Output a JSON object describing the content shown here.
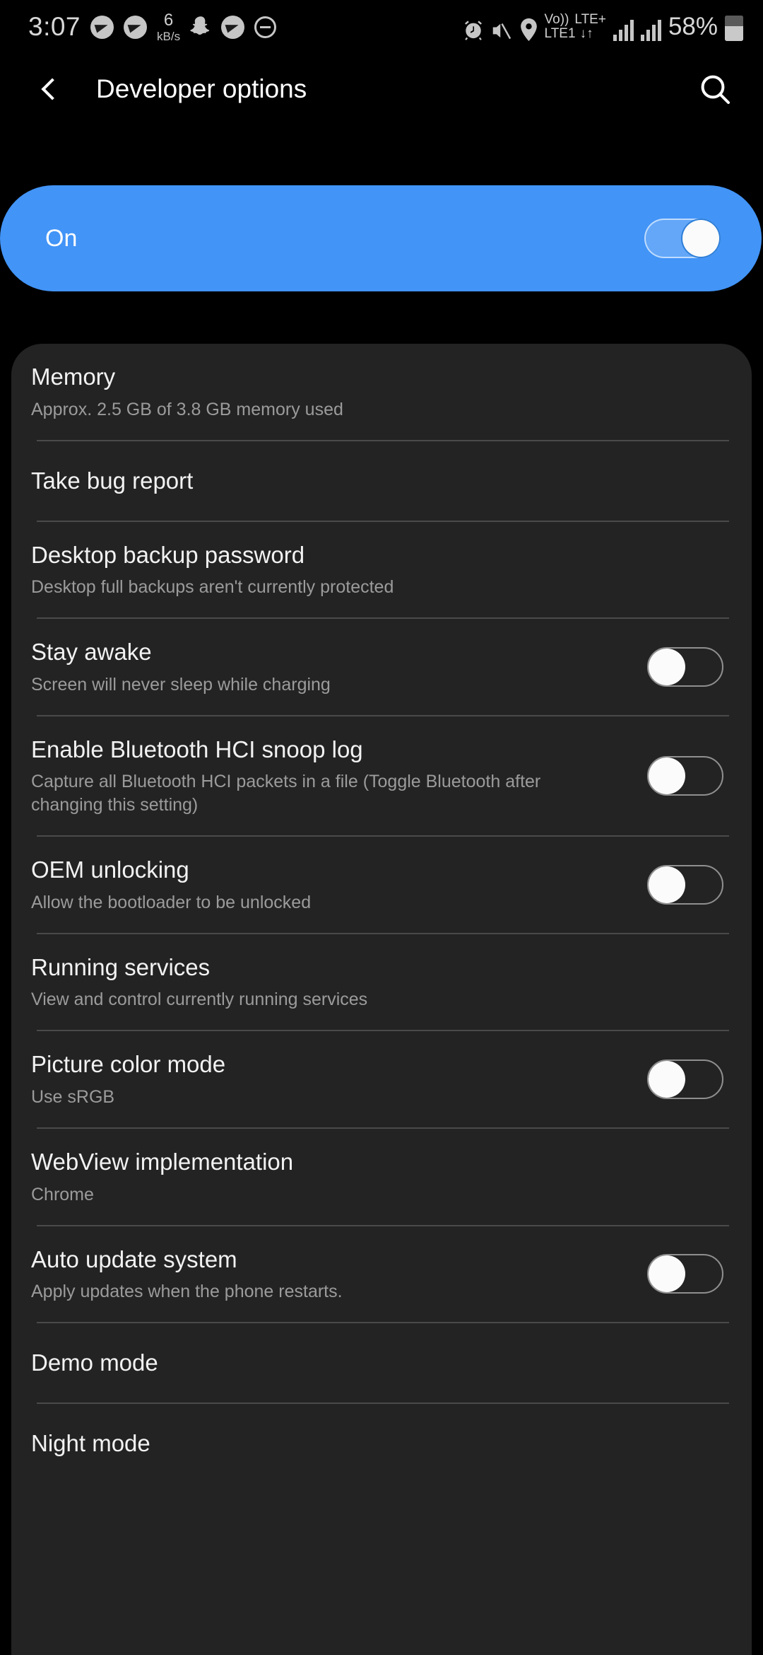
{
  "status_bar": {
    "time": "3:07",
    "left_icons": [
      "telegram-icon",
      "telegram-icon",
      "network-speed",
      "snapchat-icon",
      "telegram-icon",
      "do-not-disturb-icon"
    ],
    "network_speed_value": "6",
    "network_speed_unit": "kB/s",
    "right_icons": [
      "alarm-icon",
      "mute-icon",
      "location-icon"
    ],
    "volte_label": "Vo))",
    "volte_sim": "LTE1",
    "network_type": "LTE+",
    "data_arrows": "↓↑",
    "battery_percent": "58%"
  },
  "app_bar": {
    "title": "Developer options",
    "back_icon": "back-chevron-icon",
    "search_icon": "search-icon"
  },
  "master_switch": {
    "label": "On",
    "state": "on",
    "accent_color": "#4294f7"
  },
  "settings": [
    {
      "title": "Memory",
      "subtitle": "Approx. 2.5 GB of 3.8 GB memory used",
      "control": "none"
    },
    {
      "title": "Take bug report",
      "subtitle": "",
      "control": "none"
    },
    {
      "title": "Desktop backup password",
      "subtitle": "Desktop full backups aren't currently protected",
      "control": "none"
    },
    {
      "title": "Stay awake",
      "subtitle": "Screen will never sleep while charging",
      "control": "toggle",
      "state": "off"
    },
    {
      "title": "Enable Bluetooth HCI snoop log",
      "subtitle": "Capture all Bluetooth HCI packets in a file (Toggle Bluetooth after changing this setting)",
      "control": "toggle",
      "state": "off"
    },
    {
      "title": "OEM unlocking",
      "subtitle": "Allow the bootloader to be unlocked",
      "control": "toggle",
      "state": "off"
    },
    {
      "title": "Running services",
      "subtitle": "View and control currently running services",
      "control": "none"
    },
    {
      "title": "Picture color mode",
      "subtitle": "Use sRGB",
      "control": "toggle",
      "state": "off"
    },
    {
      "title": "WebView implementation",
      "subtitle": "Chrome",
      "control": "none"
    },
    {
      "title": "Auto update system",
      "subtitle": "Apply updates when the phone restarts.",
      "control": "toggle",
      "state": "off"
    },
    {
      "title": "Demo mode",
      "subtitle": "",
      "control": "none"
    },
    {
      "title": "Night mode",
      "subtitle": "",
      "control": "none"
    }
  ]
}
